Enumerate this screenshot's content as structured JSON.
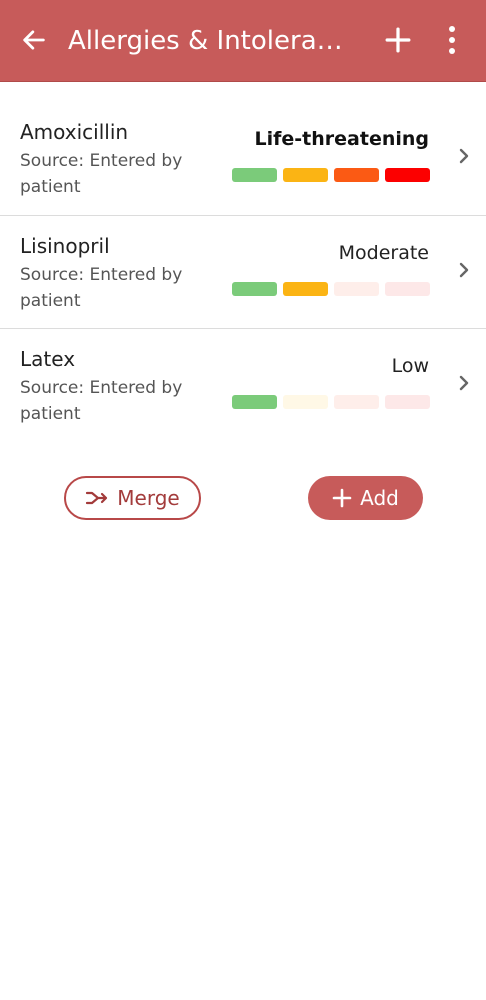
{
  "header": {
    "title": "Allergies & Intoleran…",
    "back_icon": "arrow-left-icon",
    "add_icon": "plus-icon",
    "more_icon": "more-vertical-icon"
  },
  "allergies": [
    {
      "name": "Amoxicillin",
      "source": "Source: Entered by patient",
      "severity": "Life-threatening",
      "severity_level": 4,
      "severity_max": 4
    },
    {
      "name": "Lisinopril",
      "source": "Source: Entered by patient",
      "severity": "Moderate",
      "severity_level": 2,
      "severity_max": 4
    },
    {
      "name": "Latex",
      "source": "Source: Entered by patient",
      "severity": "Low",
      "severity_level": 1,
      "severity_max": 4
    }
  ],
  "severity_colors": {
    "active": [
      "#7bcb7a",
      "#fbb414",
      "#fb5a14",
      "#fc0000"
    ],
    "inactive": [
      "#eef7ee",
      "#fff8e6",
      "#feeeea",
      "#fde8e8"
    ]
  },
  "actions": {
    "merge_label": "Merge",
    "merge_icon": "merge-icon",
    "add_label": "Add",
    "add_icon": "plus-icon"
  },
  "colors": {
    "brand": "#c75b5a",
    "accent_dark": "#a33b3b"
  }
}
